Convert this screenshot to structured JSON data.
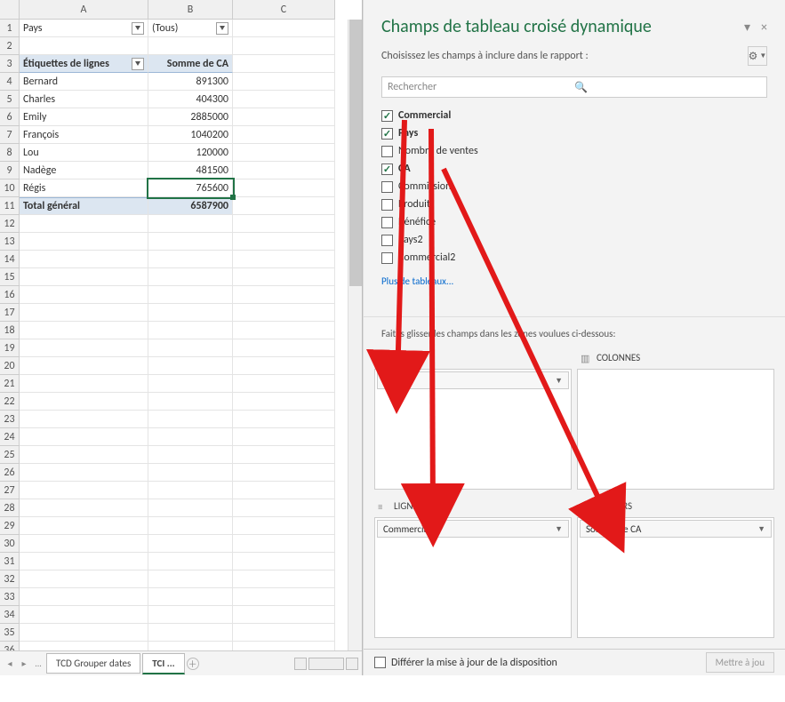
{
  "columns": [
    "A",
    "B",
    "C"
  ],
  "row_count": 37,
  "pivot": {
    "filter_field": "Pays",
    "filter_value": "(Tous)",
    "row_header": "Étiquettes de lignes",
    "value_header": "Somme de CA",
    "rows": [
      {
        "label": "Bernard",
        "value": "891300"
      },
      {
        "label": "Charles",
        "value": "404300"
      },
      {
        "label": "Emily",
        "value": "2885000"
      },
      {
        "label": "François",
        "value": "1040200"
      },
      {
        "label": "Lou",
        "value": "120000"
      },
      {
        "label": "Nadège",
        "value": "481500"
      },
      {
        "label": "Régis",
        "value": "765600"
      }
    ],
    "total_label": "Total général",
    "total_value": "6587900"
  },
  "selected_cell": {
    "row": 10,
    "col": "B"
  },
  "tabs": {
    "prev": "TCD Grouper dates",
    "active": "TCI",
    "ellipsis": "..."
  },
  "pane": {
    "title": "Champs de tableau croisé dynamique",
    "choose": "Choisissez les champs à inclure dans le rapport :",
    "search_placeholder": "Rechercher",
    "fields": [
      {
        "name": "Commercial",
        "on": true
      },
      {
        "name": "Pays",
        "on": true
      },
      {
        "name": "Nombre de ventes",
        "on": false
      },
      {
        "name": "CA",
        "on": true
      },
      {
        "name": "Commission",
        "on": false
      },
      {
        "name": "Produit",
        "on": false
      },
      {
        "name": "Bénéfice",
        "on": false
      },
      {
        "name": "Pays2",
        "on": false
      },
      {
        "name": "Commercial2",
        "on": false
      }
    ],
    "more_tables": "Plus de tableaux...",
    "drag_help": "Faites glisser les champs dans les zones voulues ci-dessous:",
    "zones": {
      "filters": {
        "label": "Filtres",
        "items": [
          "Pays"
        ]
      },
      "columns": {
        "label": "Colonnes",
        "items": []
      },
      "rows": {
        "label": "Lignes",
        "items": [
          "Commercial"
        ]
      },
      "values": {
        "label": "Valeurs",
        "items": [
          "Somme de CA"
        ]
      }
    },
    "defer": "Différer la mise à jour de la disposition",
    "update": "Mettre à jou"
  }
}
